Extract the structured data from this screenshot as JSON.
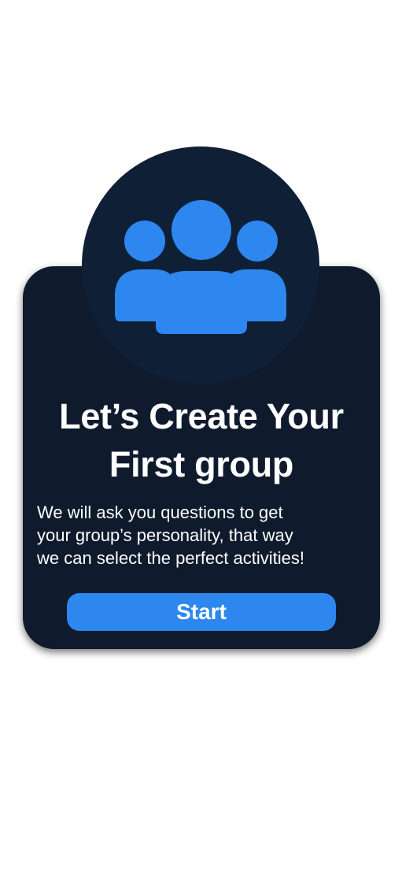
{
  "onboarding": {
    "icon": "group-users-icon",
    "title_line1": "Let’s Create Your",
    "title_line2": "First group",
    "description_line1": "We will ask you questions to get",
    "description_line2": "your group’s personality, that way",
    "description_line3": "we can select the perfect activities!",
    "start_label": "Start"
  },
  "colors": {
    "card_background": "#0f1b2d",
    "icon_circle": "#0f1f36",
    "accent_blue": "#2d87ee",
    "text": "#ffffff",
    "page_background": "#ffffff"
  }
}
